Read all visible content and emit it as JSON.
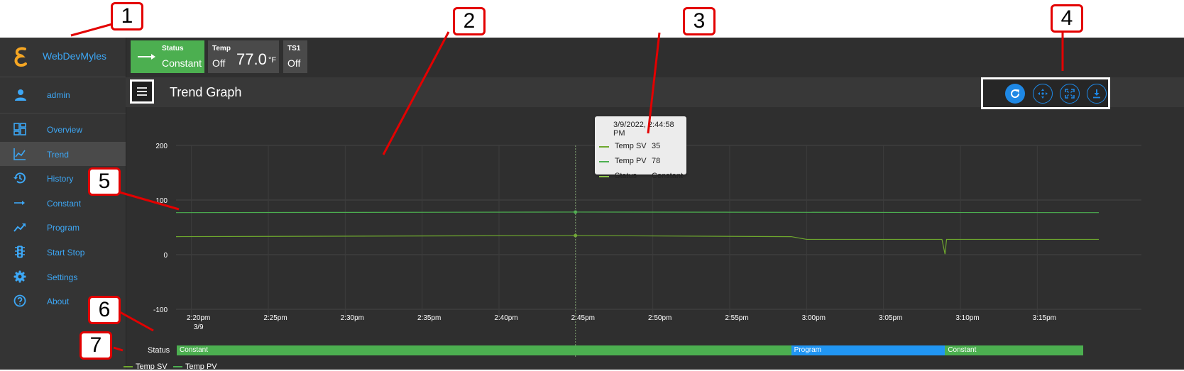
{
  "app": {
    "brand_name": "WebDevMyles",
    "brand_color": "#3da7f5",
    "user_name": "admin"
  },
  "sidebar": {
    "items": [
      {
        "label": "Overview",
        "icon": "dashboard-icon",
        "active": false
      },
      {
        "label": "Trend",
        "icon": "trend-chart-icon",
        "active": true
      },
      {
        "label": "History",
        "icon": "history-icon",
        "active": false
      },
      {
        "label": "Constant",
        "icon": "arrow-right-icon",
        "active": false
      },
      {
        "label": "Program",
        "icon": "program-icon",
        "active": false
      },
      {
        "label": "Start Stop",
        "icon": "traffic-light-icon",
        "active": false
      },
      {
        "label": "Settings",
        "icon": "gear-icon",
        "active": false
      },
      {
        "label": "About",
        "icon": "help-icon",
        "active": false
      }
    ]
  },
  "topbar": {
    "status": {
      "caption": "Status",
      "value": "Constant",
      "color": "#4caf50"
    },
    "temp": {
      "caption": "Temp",
      "state": "Off",
      "reading": "77.0",
      "unit": "°F"
    },
    "ts1": {
      "caption": "TS1",
      "state": "Off"
    }
  },
  "header": {
    "title": "Trend Graph",
    "tools": [
      "refresh-icon",
      "pan-icon",
      "fullscreen-icon",
      "download-icon"
    ]
  },
  "tooltip": {
    "timestamp": "3/9/2022, 2:44:58 PM",
    "rows": [
      {
        "name": "Temp SV",
        "value": "35"
      },
      {
        "name": "Temp PV",
        "value": "78"
      },
      {
        "name": "Status",
        "value": "Constant"
      }
    ]
  },
  "status_band": {
    "label": "Status",
    "segments": [
      {
        "label": "Constant",
        "start": "2:19pm",
        "end": "2:59pm",
        "color": "#4caf50"
      },
      {
        "label": "Program",
        "start": "2:59pm",
        "end": "3:09pm",
        "color": "#2196f3"
      },
      {
        "label": "Constant",
        "start": "3:09pm",
        "end": "3:18pm",
        "color": "#4caf50"
      }
    ]
  },
  "annotations": [
    "1",
    "2",
    "3",
    "4",
    "5",
    "6",
    "7"
  ],
  "chart_data": {
    "type": "line",
    "x_ticks": [
      "2:20pm",
      "2:25pm",
      "2:30pm",
      "2:35pm",
      "2:40pm",
      "2:45pm",
      "2:50pm",
      "2:55pm",
      "3:00pm",
      "3:05pm",
      "3:10pm",
      "3:15pm"
    ],
    "x_tick_sub": "3/9",
    "y_ticks": [
      200,
      100,
      0,
      -100
    ],
    "ylim": [
      -100,
      200
    ],
    "xlim_minutes": [
      19,
      79
    ],
    "grid": true,
    "legend": "bottom-left",
    "series": [
      {
        "name": "Temp SV",
        "color": "#6ea82e",
        "x_minutes": [
          19,
          44.97,
          59,
          60,
          68.8,
          69,
          69.1,
          79
        ],
        "values": [
          33,
          35,
          33,
          28,
          28,
          1,
          28,
          28
        ]
      },
      {
        "name": "Temp PV",
        "color": "#4caf50",
        "x_minutes": [
          19,
          44.97,
          79
        ],
        "values": [
          77,
          78,
          77
        ]
      }
    ],
    "crosshair_x_minutes": 44.97
  }
}
